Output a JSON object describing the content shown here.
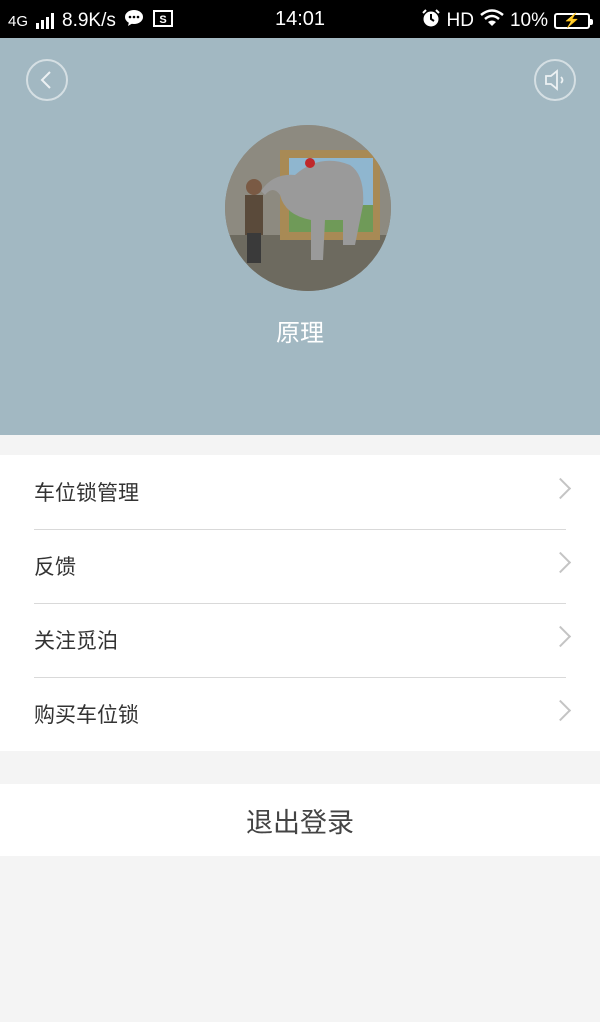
{
  "status_bar": {
    "network": "4G",
    "speed": "8.9K/s",
    "time": "14:01",
    "hd": "HD",
    "battery": "10%"
  },
  "header": {
    "background_color": "#a2b8c2",
    "username": "原理",
    "back_icon": "back-icon",
    "sound_icon": "speaker-icon"
  },
  "menu": {
    "items": [
      {
        "label": "车位锁管理"
      },
      {
        "label": "反馈"
      },
      {
        "label": "关注觅泊"
      },
      {
        "label": "购买车位锁"
      }
    ]
  },
  "logout": {
    "label": "退出登录"
  }
}
